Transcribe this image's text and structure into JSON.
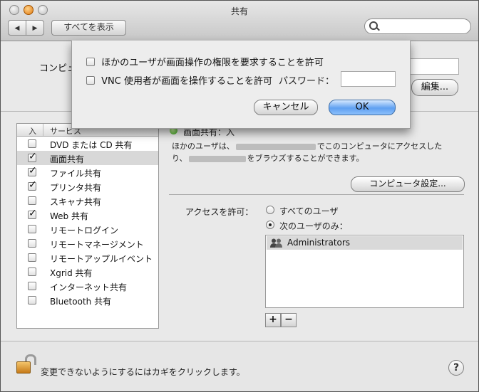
{
  "window": {
    "title": "共有"
  },
  "toolbar": {
    "show_all_label": "すべてを表示",
    "back_glyph": "◀",
    "forward_glyph": "▶",
    "search_placeholder": ""
  },
  "computer": {
    "label": "コンピュ"
  },
  "edit_label": "編集...",
  "sheet": {
    "option1_label": "ほかのユーザが画面操作の権限を要求することを許可",
    "option1_checked": false,
    "option2_label": "VNC 使用者が画面を操作することを許可",
    "option2_checked": false,
    "password_label": "パスワード：",
    "cancel_label": "キャンセル",
    "ok_label": "OK"
  },
  "services": {
    "col_on": "入",
    "col_service": "サービス",
    "items": [
      {
        "name": "DVD または CD 共有",
        "checked": false,
        "selected": false
      },
      {
        "name": "画面共有",
        "checked": true,
        "selected": true
      },
      {
        "name": "ファイル共有",
        "checked": true,
        "selected": false
      },
      {
        "name": "プリンタ共有",
        "checked": true,
        "selected": false
      },
      {
        "name": "スキャナ共有",
        "checked": false,
        "selected": false
      },
      {
        "name": "Web 共有",
        "checked": true,
        "selected": false
      },
      {
        "name": "リモートログイン",
        "checked": false,
        "selected": false
      },
      {
        "name": "リモートマネージメント",
        "checked": false,
        "selected": false
      },
      {
        "name": "リモートアップルイベント",
        "checked": false,
        "selected": false
      },
      {
        "name": "Xgrid 共有",
        "checked": false,
        "selected": false
      },
      {
        "name": "インターネット共有",
        "checked": false,
        "selected": false
      },
      {
        "name": "Bluetooth 共有",
        "checked": false,
        "selected": false
      }
    ]
  },
  "detail": {
    "status": "画面共有：入",
    "desc_line1_a": "ほかのユーザは、",
    "desc_line1_b": "でこのコンピュータにアクセスした",
    "desc_line2_a": "り、",
    "desc_line2_b": "をブラウズすることができます。",
    "computer_settings_label": "コンピュータ設定...",
    "access_label": "アクセスを許可：",
    "radio_all": "すべてのユーザ",
    "radio_only": "次のユーザのみ：",
    "users": [
      "Administrators"
    ],
    "add_label": "+",
    "remove_label": "−"
  },
  "footer": {
    "lock_text": "変更できないようにするにはカギをクリックします。",
    "help_label": "?"
  },
  "colors": {
    "ok_button": "#5fa0f1",
    "status_green": "#2f9b12",
    "lock_gold": "#e0a33c"
  }
}
